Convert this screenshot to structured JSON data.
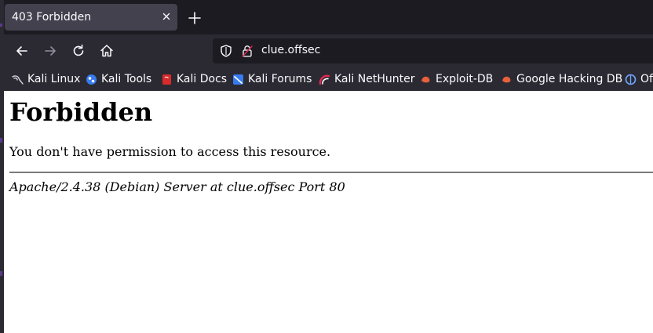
{
  "tab": {
    "title": "403 Forbidden"
  },
  "navigation": {
    "url": "clue.offsec"
  },
  "bookmarks": [
    {
      "label": "Kali Linux",
      "icon": "kali-dragon-icon"
    },
    {
      "label": "Kali Tools",
      "icon": "kali-tools-icon"
    },
    {
      "label": "Kali Docs",
      "icon": "kali-docs-icon"
    },
    {
      "label": "Kali Forums",
      "icon": "kali-forums-icon"
    },
    {
      "label": "Kali NetHunter",
      "icon": "kali-nethunter-icon"
    },
    {
      "label": "Exploit-DB",
      "icon": "exploit-db-icon"
    },
    {
      "label": "Google Hacking DB",
      "icon": "ghdb-icon"
    },
    {
      "label": "OffSec",
      "icon": "offsec-icon"
    }
  ],
  "page": {
    "heading": "Forbidden",
    "message": "You don't have permission to access this resource.",
    "server_signature": "Apache/2.4.38 (Debian) Server at clue.offsec Port 80"
  },
  "colors": {
    "chrome_dark": "#1c1b22",
    "chrome": "#2b2a33",
    "active_tab": "#42414d",
    "exploit_orange": "#e8603c"
  }
}
